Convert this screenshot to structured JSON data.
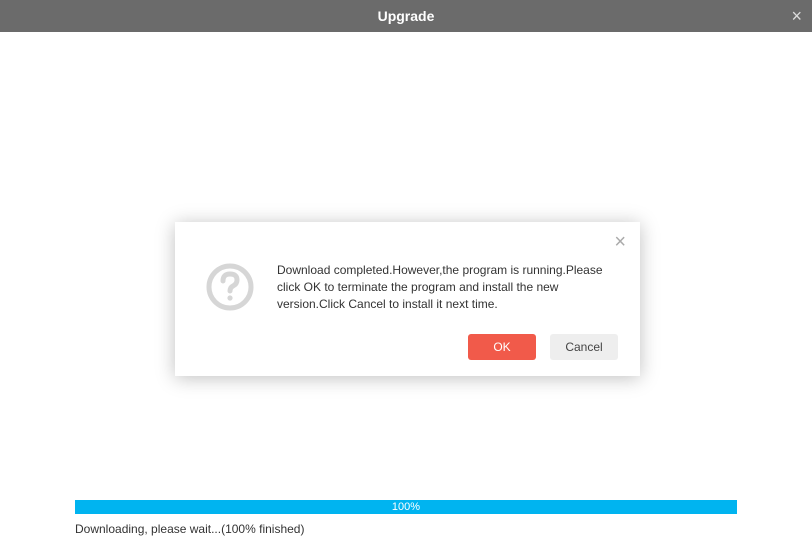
{
  "titlebar": {
    "title": "Upgrade"
  },
  "dialog": {
    "message": "Download completed.However,the program is running.Please click OK to terminate the program and install the new version.Click Cancel to install it next time.",
    "ok_label": "OK",
    "cancel_label": "Cancel"
  },
  "progress": {
    "percent_label": "100%",
    "status_text": "Downloading, please wait...(100% finished)"
  },
  "colors": {
    "accent": "#00b4f0",
    "primary_button": "#f15a4a",
    "titlebar": "#6b6b6b"
  }
}
